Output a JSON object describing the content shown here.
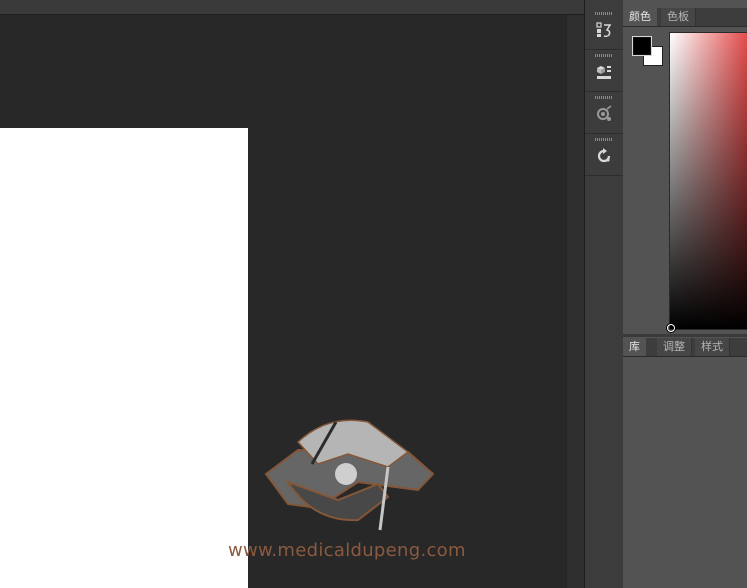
{
  "toolbar": {
    "collapse_glyph": "◂◂"
  },
  "dock": {
    "buttons": [
      {
        "name": "history",
        "icon": "history-icon"
      },
      {
        "name": "properties",
        "icon": "properties-icon"
      },
      {
        "name": "brush-settings",
        "icon": "brush-settings-icon"
      },
      {
        "name": "adjustment",
        "icon": "rotate-icon"
      }
    ]
  },
  "color_panel": {
    "tabs": [
      "颜色",
      "色板"
    ],
    "active_tab": 0,
    "foreground": "#000000",
    "background": "#ffffff",
    "hue_color": "#e44a4a"
  },
  "library_panel": {
    "tabs": [
      "库",
      "调整",
      "样式"
    ],
    "active_tab": 0
  },
  "watermark": {
    "text": "www.medicaldupeng.com"
  }
}
